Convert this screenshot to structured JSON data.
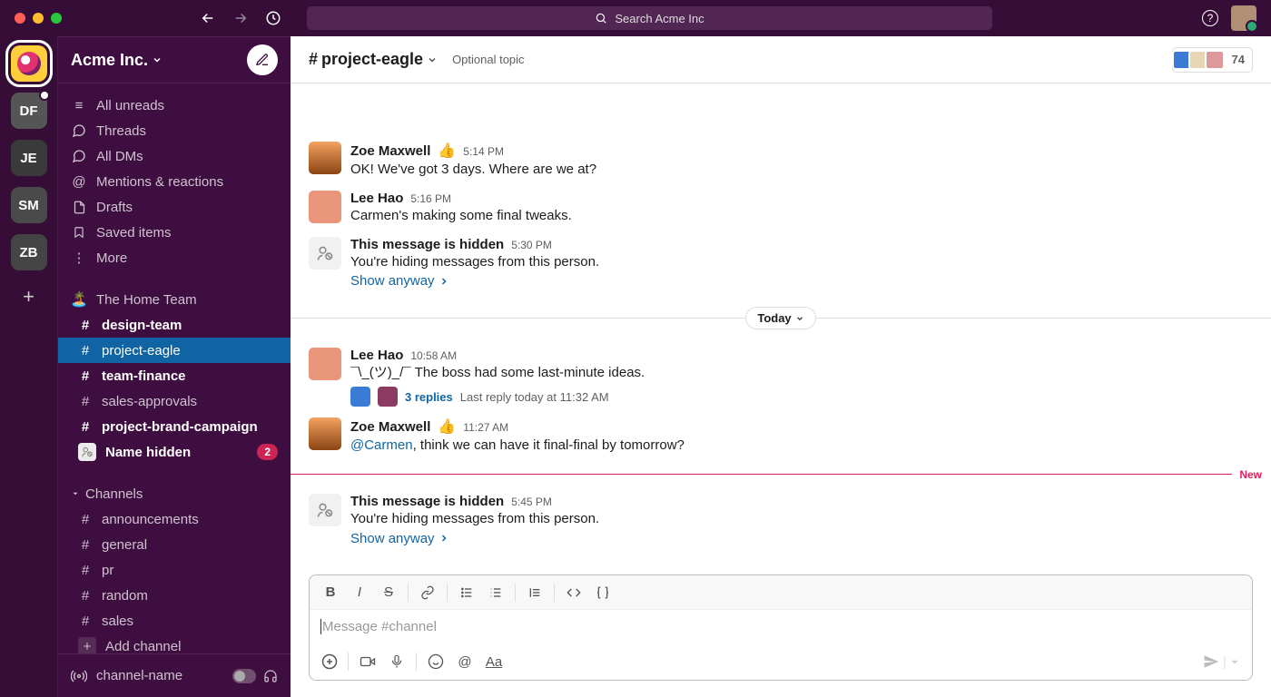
{
  "search": {
    "placeholder": "Search Acme Inc"
  },
  "workspace": {
    "name": "Acme Inc."
  },
  "rail": [
    {
      "initials": "",
      "active": true
    },
    {
      "initials": "DF",
      "dot": true
    },
    {
      "initials": "JE"
    },
    {
      "initials": "SM"
    },
    {
      "initials": "ZB"
    }
  ],
  "sidebar": {
    "nav": {
      "unreads": "All unreads",
      "threads": "Threads",
      "dms": "All DMs",
      "mentions": "Mentions & reactions",
      "drafts": "Drafts",
      "saved": "Saved items",
      "more": "More"
    },
    "team_section": "The Home Team",
    "team_channels": [
      {
        "name": "design-team",
        "bold": true
      },
      {
        "name": "project-eagle",
        "bold": false,
        "active": true
      },
      {
        "name": "team-finance",
        "bold": true
      },
      {
        "name": "sales-approvals",
        "bold": false
      },
      {
        "name": "project-brand-campaign",
        "bold": true
      }
    ],
    "hidden_dm": {
      "label": "Name hidden",
      "badge": "2"
    },
    "channels_heading": "Channels",
    "channels": [
      {
        "name": "announcements"
      },
      {
        "name": "general"
      },
      {
        "name": "pr"
      },
      {
        "name": "random"
      },
      {
        "name": "sales"
      }
    ],
    "add_channel": "Add channel",
    "footer_channel": "channel-name"
  },
  "channel_header": {
    "name": "project-eagle",
    "topic": "Optional topic",
    "member_count": "74"
  },
  "messages": {
    "m1": {
      "author": "Zoe Maxwell",
      "time": "5:14 PM",
      "text": "OK! We've got 3 days. Where are we at?"
    },
    "m2": {
      "author": "Lee Hao",
      "time": "5:16 PM",
      "text": "Carmen's making some final tweaks."
    },
    "m3": {
      "author": "This message is hidden",
      "time": "5:30 PM",
      "text": "You're hiding messages from this person.",
      "show": "Show anyway"
    },
    "divider": "Today",
    "m4": {
      "author": "Lee Hao",
      "time": "10:58 AM",
      "text": "¯\\_(ツ)_/¯ The boss had some last-minute ideas.",
      "replies": "3 replies",
      "last_reply": "Last reply today at 11:32 AM"
    },
    "m5": {
      "author": "Zoe Maxwell",
      "time": "11:27 AM",
      "mention": "@Carmen",
      "rest": ", think we can have it final-final by tomorrow?"
    },
    "new_label": "New",
    "m6": {
      "author": "This message is hidden",
      "time": "5:45 PM",
      "text": "You're hiding messages from this person.",
      "show": "Show anyway"
    }
  },
  "composer": {
    "placeholder": "Message #channel"
  }
}
